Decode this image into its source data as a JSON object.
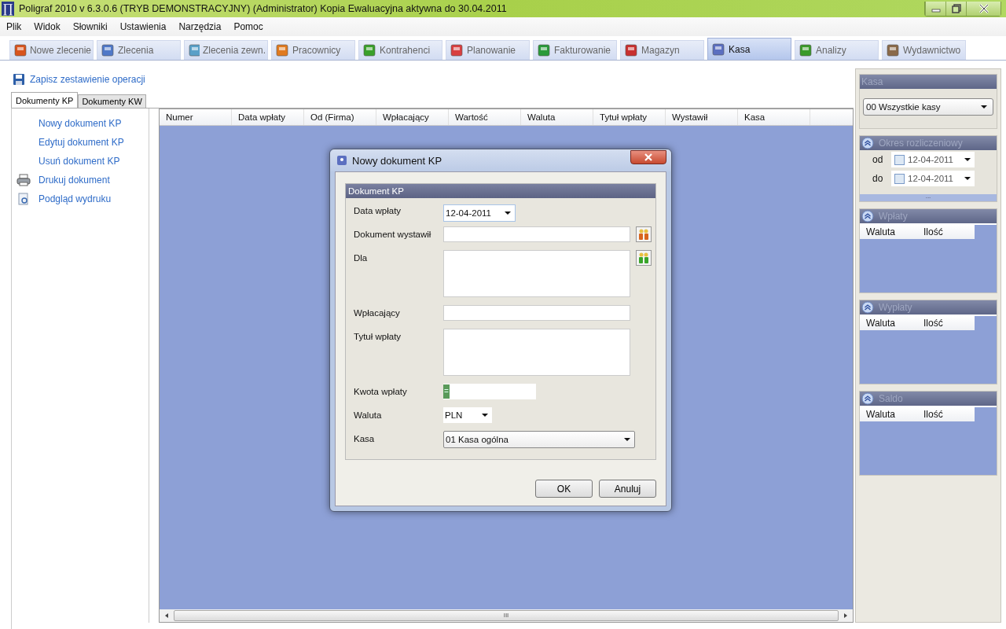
{
  "window": {
    "app_mark": "∏",
    "title": "Poligraf 2010 v 6.3.0.6 (TRYB DEMONSTRACYJNY) (Administrator) Kopia Ewaluacyjna aktywna do 30.04.2011"
  },
  "menu": [
    "Plik",
    "Widok",
    "Słowniki",
    "Ustawienia",
    "Narzędzia",
    "Pomoc"
  ],
  "tabs": [
    {
      "label": "Nowe zlecenie",
      "selected": false
    },
    {
      "label": "Zlecenia",
      "selected": false
    },
    {
      "label": "Zlecenia zewn.",
      "selected": false
    },
    {
      "label": "Pracownicy",
      "selected": false
    },
    {
      "label": "Kontrahenci",
      "selected": false
    },
    {
      "label": "Planowanie",
      "selected": false
    },
    {
      "label": "Fakturowanie",
      "selected": false
    },
    {
      "label": "Magazyn",
      "selected": false
    },
    {
      "label": "Kasa",
      "selected": true
    },
    {
      "label": "Analizy",
      "selected": false
    },
    {
      "label": "Wydawnictwo",
      "selected": false
    }
  ],
  "save_link": "Zapisz zestawienie operacji",
  "doc_tabs": [
    {
      "label": "Dokumenty KP",
      "selected": true
    },
    {
      "label": "Dokumenty KW",
      "selected": false
    }
  ],
  "actions": [
    {
      "label": "Nowy dokument KP",
      "kind": "plain"
    },
    {
      "label": "Edytuj dokument KP",
      "kind": "plain"
    },
    {
      "label": "Usuń dokument KP",
      "kind": "plain"
    },
    {
      "label": "Drukuj dokument",
      "kind": "print"
    },
    {
      "label": "Podgląd wydruku",
      "kind": "preview"
    }
  ],
  "table": {
    "columns": [
      "Numer",
      "Data wpłaty",
      "Od (Firma)",
      "Wpłacający",
      "Wartość",
      "Waluta",
      "Tytuł wpłaty",
      "Wystawił",
      "Kasa"
    ],
    "scroll_grip": "III"
  },
  "dialog": {
    "title": "Nowy dokument KP",
    "group": "Dokument KP",
    "fields": [
      {
        "label": "Data wpłaty",
        "kind": "date",
        "value": "12-04-2011"
      },
      {
        "label": "Dokument wystawił",
        "kind": "text",
        "button": true
      },
      {
        "label": "Dla",
        "kind": "area",
        "button": true
      },
      {
        "label": "Wpłacający",
        "kind": "text",
        "button": false
      },
      {
        "label": "Tytuł wpłaty",
        "kind": "area",
        "button": false
      },
      {
        "label": "Kwota wpłaty",
        "kind": "amount",
        "prefix": "="
      },
      {
        "label": "Waluta",
        "kind": "small-select",
        "value": "PLN"
      },
      {
        "label": "Kasa",
        "kind": "select",
        "value": "01 Kasa ogólna"
      }
    ],
    "buttons": [
      "OK",
      "Anuluj"
    ]
  },
  "side": {
    "sections": [
      {
        "title": "Kasa",
        "kind": "combo",
        "collapsible": false,
        "value": "00 Wszystkie kasy"
      },
      {
        "title": "Okres rozliczeniowy",
        "kind": "period",
        "collapsible": true,
        "rows": [
          {
            "label": "od",
            "value": "12-04-2011"
          },
          {
            "label": "do",
            "value": "12-04-2011"
          }
        ],
        "grip": "..."
      },
      {
        "title": "Wpłaty",
        "kind": "grid",
        "collapsible": true,
        "columns": [
          "Waluta",
          "Ilość"
        ]
      },
      {
        "title": "Wypłaty",
        "kind": "grid",
        "collapsible": true,
        "columns": [
          "Waluta",
          "Ilość"
        ]
      },
      {
        "title": "Saldo",
        "kind": "grid",
        "collapsible": true,
        "columns": [
          "Waluta",
          "Ilość"
        ]
      }
    ]
  }
}
